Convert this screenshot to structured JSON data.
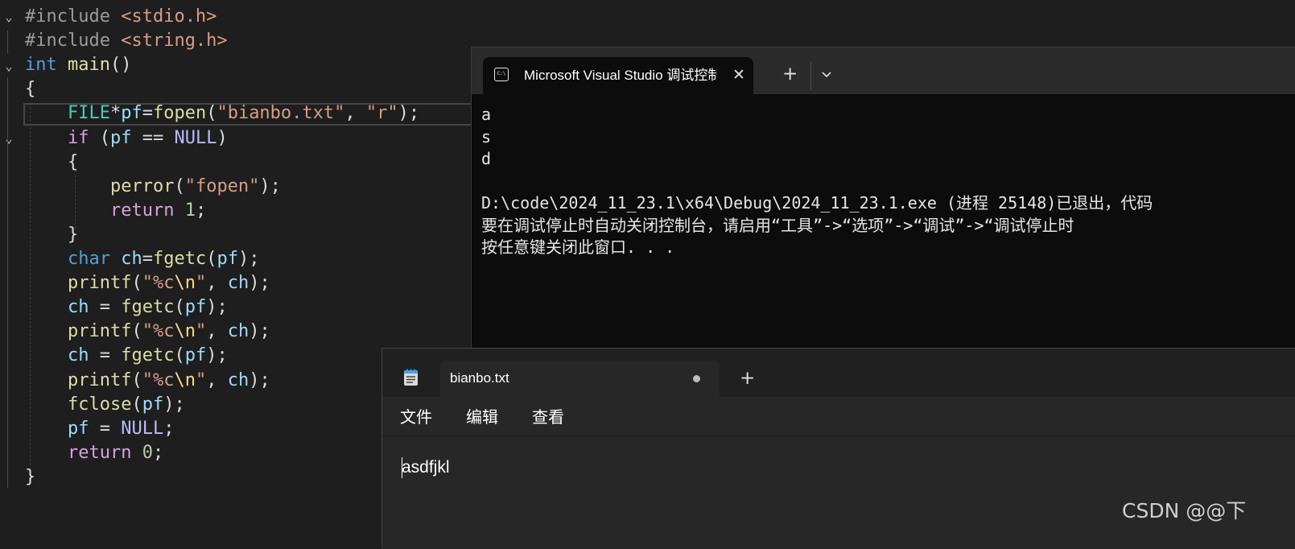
{
  "editor": {
    "lines": [
      [
        [
          "pp",
          "#include "
        ],
        [
          "str",
          "<stdio.h>"
        ]
      ],
      [
        [
          "pp",
          "#include "
        ],
        [
          "str",
          "<string.h>"
        ]
      ],
      [
        [
          "kw",
          "int"
        ],
        [
          "p",
          " "
        ],
        [
          "fn",
          "main"
        ],
        [
          "p",
          "()"
        ]
      ],
      [
        [
          "p",
          "{"
        ]
      ],
      [
        [
          "p",
          "    "
        ],
        [
          "ty",
          "FILE"
        ],
        [
          "p",
          "*"
        ],
        [
          "var",
          "pf"
        ],
        [
          "p",
          "="
        ],
        [
          "fn",
          "fopen"
        ],
        [
          "p",
          "("
        ],
        [
          "str",
          "\"bianbo.txt\""
        ],
        [
          "p",
          ", "
        ],
        [
          "str",
          "\"r\""
        ],
        [
          "p",
          ");"
        ]
      ],
      [
        [
          "p",
          "    "
        ],
        [
          "kw2",
          "if"
        ],
        [
          "p",
          " ("
        ],
        [
          "var",
          "pf"
        ],
        [
          "p",
          " == "
        ],
        [
          "macro",
          "NULL"
        ],
        [
          "p",
          ")"
        ]
      ],
      [
        [
          "p",
          "    {"
        ]
      ],
      [
        [
          "p",
          "        "
        ],
        [
          "fn",
          "perror"
        ],
        [
          "p",
          "("
        ],
        [
          "str",
          "\"fopen\""
        ],
        [
          "p",
          ");"
        ]
      ],
      [
        [
          "p",
          "        "
        ],
        [
          "kw2",
          "return"
        ],
        [
          "p",
          " "
        ],
        [
          "num",
          "1"
        ],
        [
          "p",
          ";"
        ]
      ],
      [
        [
          "p",
          "    }"
        ]
      ],
      [
        [
          "p",
          "    "
        ],
        [
          "kw",
          "char"
        ],
        [
          "p",
          " "
        ],
        [
          "var",
          "ch"
        ],
        [
          "p",
          "="
        ],
        [
          "fn",
          "fgetc"
        ],
        [
          "p",
          "("
        ],
        [
          "var",
          "pf"
        ],
        [
          "p",
          ");"
        ]
      ],
      [
        [
          "p",
          "    "
        ],
        [
          "fn",
          "printf"
        ],
        [
          "p",
          "("
        ],
        [
          "str",
          "\"%c"
        ],
        [
          "esc",
          "\\n"
        ],
        [
          "str",
          "\""
        ],
        [
          "p",
          ", "
        ],
        [
          "var",
          "ch"
        ],
        [
          "p",
          ");"
        ]
      ],
      [
        [
          "p",
          "    "
        ],
        [
          "var",
          "ch"
        ],
        [
          "p",
          " = "
        ],
        [
          "fn",
          "fgetc"
        ],
        [
          "p",
          "("
        ],
        [
          "var",
          "pf"
        ],
        [
          "p",
          ");"
        ]
      ],
      [
        [
          "p",
          "    "
        ],
        [
          "fn",
          "printf"
        ],
        [
          "p",
          "("
        ],
        [
          "str",
          "\"%c"
        ],
        [
          "esc",
          "\\n"
        ],
        [
          "str",
          "\""
        ],
        [
          "p",
          ", "
        ],
        [
          "var",
          "ch"
        ],
        [
          "p",
          ");"
        ]
      ],
      [
        [
          "p",
          "    "
        ],
        [
          "var",
          "ch"
        ],
        [
          "p",
          " = "
        ],
        [
          "fn",
          "fgetc"
        ],
        [
          "p",
          "("
        ],
        [
          "var",
          "pf"
        ],
        [
          "p",
          ");"
        ]
      ],
      [
        [
          "p",
          "    "
        ],
        [
          "fn",
          "printf"
        ],
        [
          "p",
          "("
        ],
        [
          "str",
          "\"%c"
        ],
        [
          "esc",
          "\\n"
        ],
        [
          "str",
          "\""
        ],
        [
          "p",
          ", "
        ],
        [
          "var",
          "ch"
        ],
        [
          "p",
          ");"
        ]
      ],
      [
        [
          "p",
          "    "
        ],
        [
          "fn",
          "fclose"
        ],
        [
          "p",
          "("
        ],
        [
          "var",
          "pf"
        ],
        [
          "p",
          ");"
        ]
      ],
      [
        [
          "p",
          "    "
        ],
        [
          "var",
          "pf"
        ],
        [
          "p",
          " = "
        ],
        [
          "macro",
          "NULL"
        ],
        [
          "p",
          ";"
        ]
      ],
      [
        [
          "p",
          "    "
        ],
        [
          "kw2",
          "return"
        ],
        [
          "p",
          " "
        ],
        [
          "num",
          "0"
        ],
        [
          "p",
          ";"
        ]
      ],
      [
        [
          "p",
          "}"
        ]
      ]
    ]
  },
  "console": {
    "tab_title": "Microsoft Visual Studio 调试控制台",
    "close_glyph": "✕",
    "new_tab_glyph": "+",
    "output_lines": [
      "a",
      "s",
      "d",
      "",
      "D:\\code\\2024_11_23.1\\x64\\Debug\\2024_11_23.1.exe (进程 25148)已退出，代码",
      "要在调试停止时自动关闭控制台，请启用“工具”->“选项”->“调试”->“调试停止时",
      "按任意键关闭此窗口. . ."
    ]
  },
  "notepad": {
    "tab_title": "bianbo.txt",
    "new_tab_glyph": "+",
    "menu": {
      "file": "文件",
      "edit": "编辑",
      "view": "查看"
    },
    "content": "asdfjkl"
  },
  "watermark": "CSDN @@下"
}
